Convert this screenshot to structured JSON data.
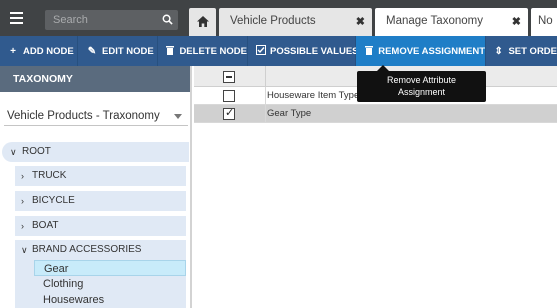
{
  "topbar": {
    "search_placeholder": "Search",
    "tabs": [
      {
        "label": "",
        "icon": "home-icon"
      },
      {
        "label": "Vehicle Products",
        "close": "✖"
      },
      {
        "label": "Manage Taxonomy",
        "close": "✖"
      },
      {
        "label": "No"
      }
    ]
  },
  "toolbar": {
    "buttons": [
      {
        "label": "ADD NODE",
        "icon": "+"
      },
      {
        "label": "EDIT NODE",
        "icon": "✎"
      },
      {
        "label": "DELETE NODE",
        "icon": "🗑"
      },
      {
        "label": "POSSIBLE VALUES",
        "icon": "☑"
      },
      {
        "label": "REMOVE ASSIGNMENT",
        "icon": "🗑"
      },
      {
        "label": "SET ORDE",
        "icon": "⇕"
      }
    ],
    "active_color": "#1f7ec7",
    "bar_color": "#305a8e"
  },
  "tooltip": {
    "line1": "Remove Attribute",
    "line2": "Assignment"
  },
  "left_panel": {
    "header": "TAXONOMY",
    "taxonomy_select": "Vehicle Products - Traxonomy",
    "tree": {
      "root": "ROOT",
      "nodes": [
        "TRUCK",
        "BICYCLE",
        "BOAT",
        "BRAND ACCESSORIES"
      ],
      "children": [
        "Gear",
        "Clothing",
        "Housewares"
      ]
    }
  },
  "grid": {
    "rows": [
      {
        "name": "Houseware Item Type",
        "checked": false
      },
      {
        "name": "Gear Type",
        "checked": true
      }
    ]
  }
}
